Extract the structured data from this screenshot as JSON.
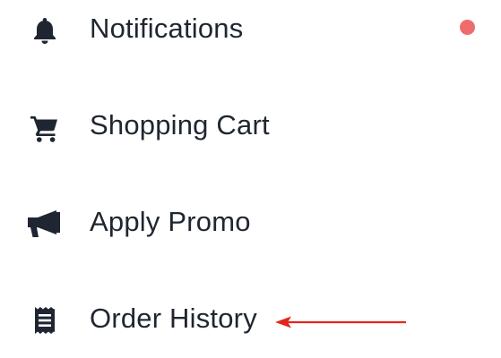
{
  "menu": {
    "items": [
      {
        "label": "Notifications",
        "icon": "bell-icon",
        "has_unread": true
      },
      {
        "label": "Shopping Cart",
        "icon": "shopping-cart-icon"
      },
      {
        "label": "Apply Promo",
        "icon": "megaphone-icon"
      },
      {
        "label": "Order History",
        "icon": "receipt-icon"
      }
    ]
  },
  "colors": {
    "text": "#1f2631",
    "icon": "#1f2631",
    "unread_dot": "#ee6b6e",
    "annotation_arrow": "#e2261b"
  },
  "annotation": {
    "type": "arrow",
    "points_to": "Order History",
    "direction": "left"
  }
}
